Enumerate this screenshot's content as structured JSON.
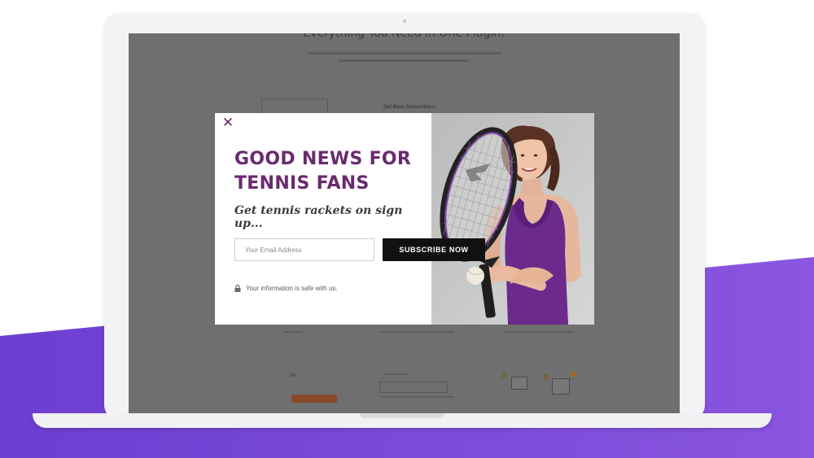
{
  "colors": {
    "accent_purple": "#6a2a6e",
    "band_purple": "#7a4fd6",
    "screen_overlay": "#6f6f6f",
    "button_black": "#111111"
  },
  "background_page": {
    "heading": "Everything You Need in One Plugin!",
    "sidebar_title": "Get More Subscribers!"
  },
  "popup": {
    "close_icon": "close-icon",
    "headline_line1": "GOOD NEWS FOR",
    "headline_line2": "TENNIS FANS",
    "tagline": "Get tennis rackets on sign up...",
    "email_placeholder": "Your Email Address",
    "subscribe_label": "SUBSCRIBE NOW",
    "privacy_text": "Your information is safe with us.",
    "privacy_icon": "lock-icon",
    "image": "woman-with-tennis-racket-photo"
  },
  "background_labels": {
    "letter_a": "A",
    "letter_b": "B"
  }
}
